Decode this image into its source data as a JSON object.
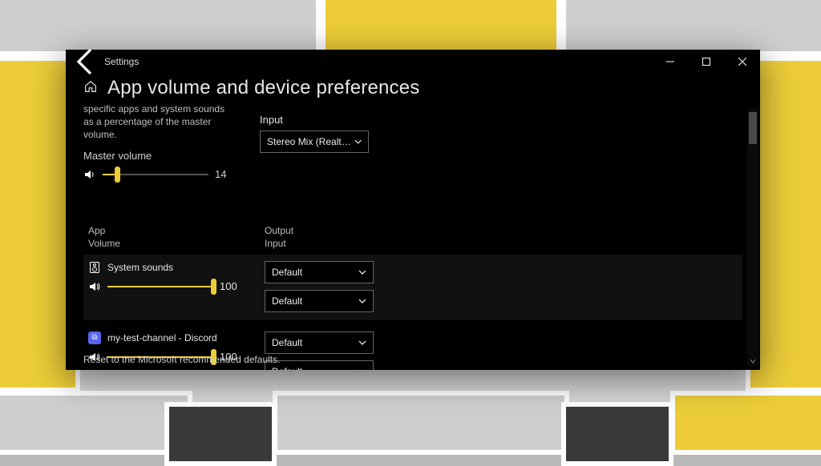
{
  "titlebar": {
    "label": "Settings"
  },
  "header": {
    "title": "App volume and device preferences"
  },
  "master": {
    "desc_partial": "specific apps and system sounds as a percentage of the master volume.",
    "label": "Master volume",
    "value": "14",
    "percent": 14
  },
  "input": {
    "label": "Input",
    "selected": "Stereo Mix (Realtek..."
  },
  "columns": {
    "app": "App",
    "volume": "Volume",
    "output": "Output",
    "input": "Input"
  },
  "apps": [
    {
      "name": "System sounds",
      "volume": "100",
      "percent": 100,
      "output": "Default",
      "input": "Default",
      "icon": "system"
    },
    {
      "name": "my-test-channel - Discord",
      "volume": "100",
      "percent": 100,
      "output": "Default",
      "input": "Default",
      "icon": "discord"
    }
  ],
  "footer": {
    "reset": "Reset to the Microsoft recommended defaults."
  }
}
